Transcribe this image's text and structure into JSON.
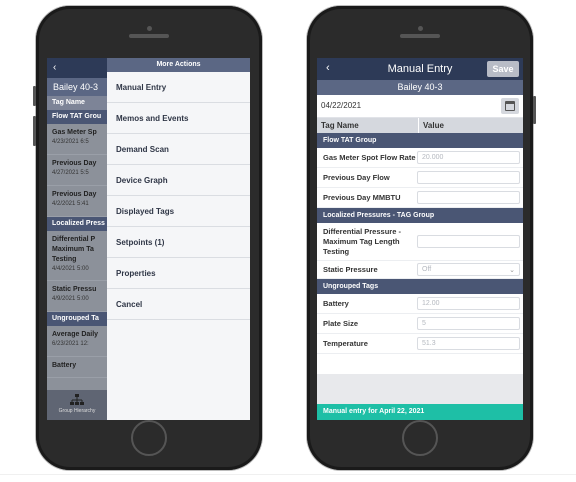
{
  "left_screen": {
    "background_app": {
      "back_glyph": "‹",
      "title": "Bailey 40-3",
      "column_header": "Tag Name",
      "rows": [
        {
          "type": "group",
          "label": "Flow TAT Grou"
        },
        {
          "type": "row",
          "name": "Gas Meter Sp",
          "date": "4/23/2021 6:5"
        },
        {
          "type": "row",
          "name": "Previous Day",
          "date": "4/27/2021 5:5"
        },
        {
          "type": "row",
          "name": "Previous Day",
          "date": "4/2/2021 5:41"
        },
        {
          "type": "group",
          "label": "Localized Press"
        },
        {
          "type": "tall",
          "name": "Differential P",
          "name2": "Maximum Ta",
          "name3": "Testing",
          "date": "4/4/2021 5:00"
        },
        {
          "type": "row",
          "name": "Static Pressu",
          "date": "4/9/2021 5:00"
        },
        {
          "type": "group",
          "label": "Ungrouped Ta"
        },
        {
          "type": "row",
          "name": "Average Daily",
          "date": "6/23/2021 12:"
        },
        {
          "type": "short",
          "name": "Battery",
          "date": ""
        }
      ],
      "bottom_label": "Group Hierarchy"
    },
    "menu": {
      "header": "More Actions",
      "items": [
        "Manual Entry",
        "Memos and Events",
        "Demand Scan",
        "Device Graph",
        "Displayed Tags",
        "Setpoints (1)",
        "Properties",
        "Cancel"
      ]
    }
  },
  "right_screen": {
    "nav": {
      "back_glyph": "‹",
      "title": "Manual Entry",
      "save_label": "Save"
    },
    "subtitle": "Bailey 40-3",
    "date_value": "04/22/2021",
    "columns": {
      "name": "Tag Name",
      "value": "Value"
    },
    "groups": [
      {
        "label": "Flow TAT Group",
        "rows": [
          {
            "label": "Gas Meter Spot Flow Rate",
            "value": "20.000"
          },
          {
            "label": "Previous Day Flow",
            "value": ""
          },
          {
            "label": "Previous Day MMBTU",
            "value": ""
          }
        ]
      },
      {
        "label": "Localized Pressures - TAG Group",
        "rows": [
          {
            "label": "Differential Pressure - Maximum Tag Length Testing",
            "value": ""
          },
          {
            "label": "Static Pressure",
            "value": "Off",
            "select": true
          }
        ]
      },
      {
        "label": "Ungrouped Tags",
        "rows": [
          {
            "label": "Battery",
            "value": "12.00"
          },
          {
            "label": "Plate Size",
            "value": "5"
          },
          {
            "label": "Temperature",
            "value": "51.3"
          }
        ]
      }
    ],
    "footer": "Manual entry for April 22, 2021"
  },
  "colors": {
    "nav": "#2d3a57",
    "subheader": "#5b6784",
    "group": "#4a5674",
    "footer_accent": "#1ebfa6"
  }
}
